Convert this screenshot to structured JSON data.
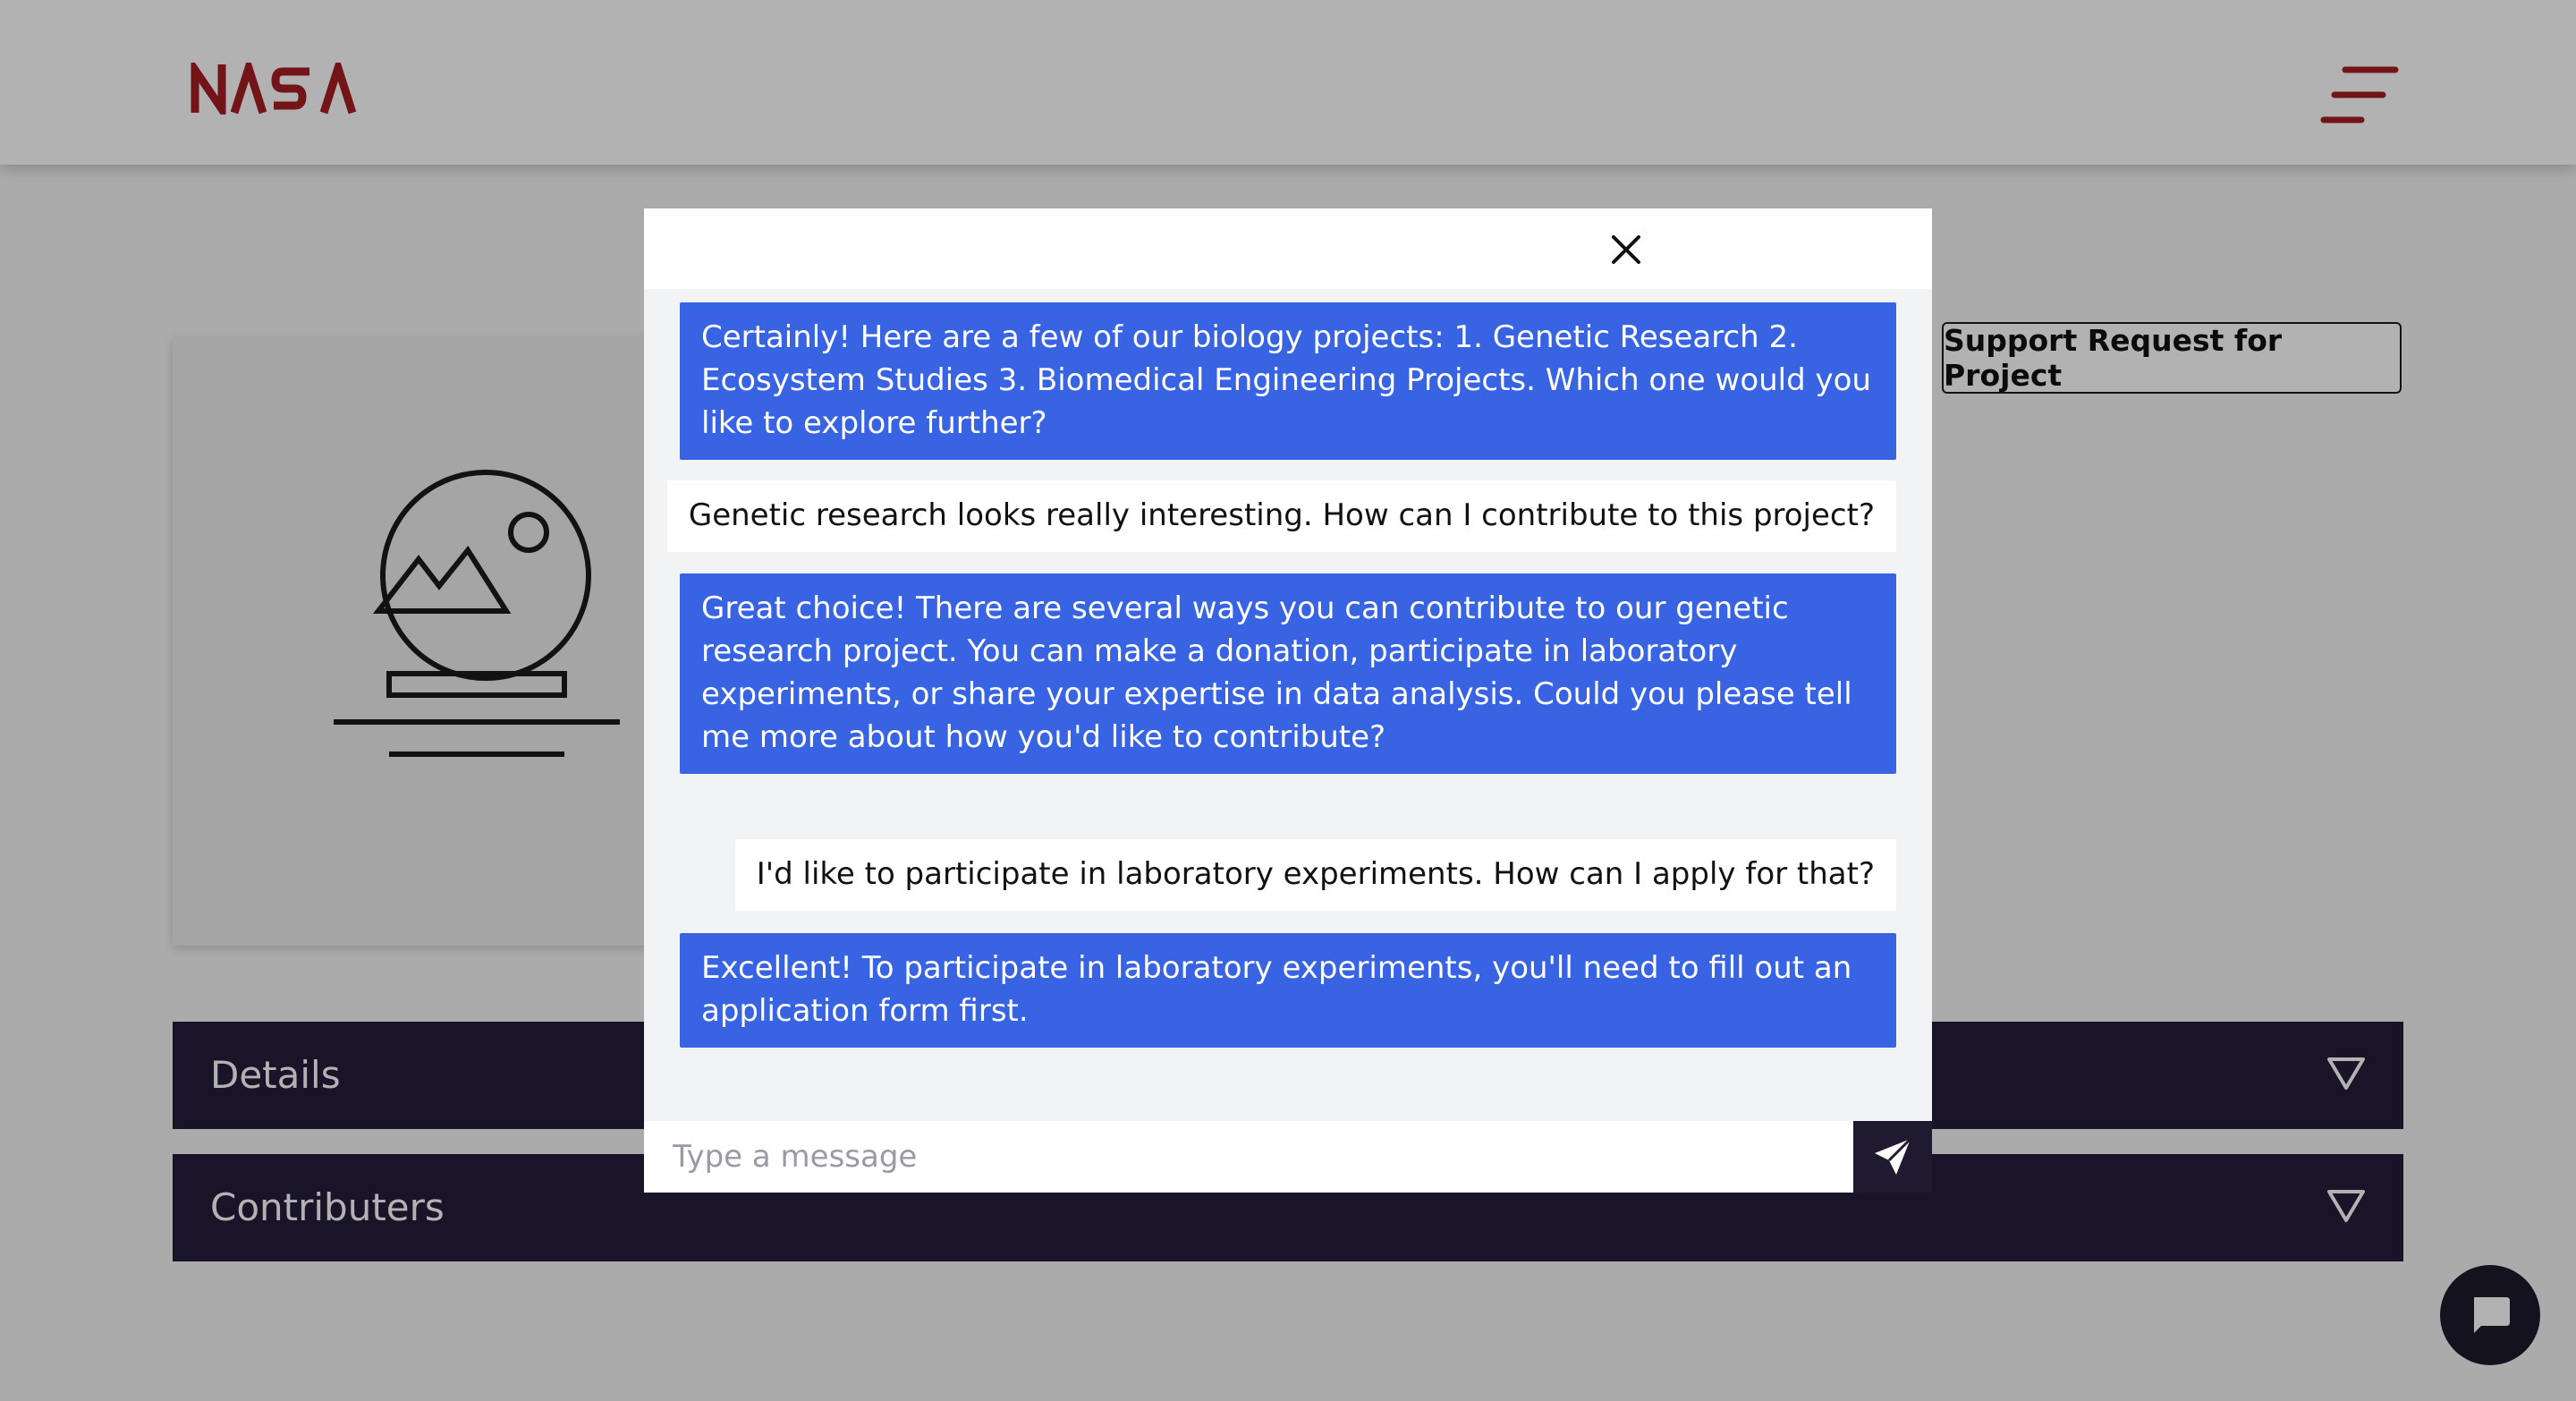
{
  "header": {
    "logo_text": "NASA",
    "menu_icon": "hamburger-menu-icon",
    "brand_color": "#a51d24"
  },
  "project": {
    "image_icon": "image-placeholder-icon",
    "support_button_label": "Support Request for Project"
  },
  "sections": [
    {
      "title": "Details",
      "icon": "triangle-down-icon"
    },
    {
      "title": "Contributers",
      "icon": "triangle-down-icon"
    }
  ],
  "chat": {
    "close_icon": "close-icon",
    "messages": [
      {
        "sender": "bot",
        "text": "Certainly! Here are a few of our biology projects: 1. Genetic Research 2. Ecosystem Studies 3. Biomedical Engineering Projects. Which one would you like to explore further?"
      },
      {
        "sender": "user",
        "text": "Genetic research looks really interesting. How can I contribute to this project?"
      },
      {
        "sender": "bot",
        "text": "Great choice! There are several ways you can contribute to our genetic research project. You can make a donation, participate in laboratory experiments, or share your expertise in data analysis. Could you please tell me more about how you'd like to contribute?"
      },
      {
        "sender": "user",
        "text": "I'd like to participate in laboratory experiments. How can I apply for that?"
      },
      {
        "sender": "bot",
        "text": "Excellent! To participate in laboratory experiments, you'll need to fill out an application form first."
      }
    ],
    "input_placeholder": "Type a message",
    "input_value": "",
    "send_icon": "send-icon",
    "bot_bubble_color": "#3864e3"
  },
  "chat_launcher": {
    "icon": "chat-bubble-icon"
  }
}
